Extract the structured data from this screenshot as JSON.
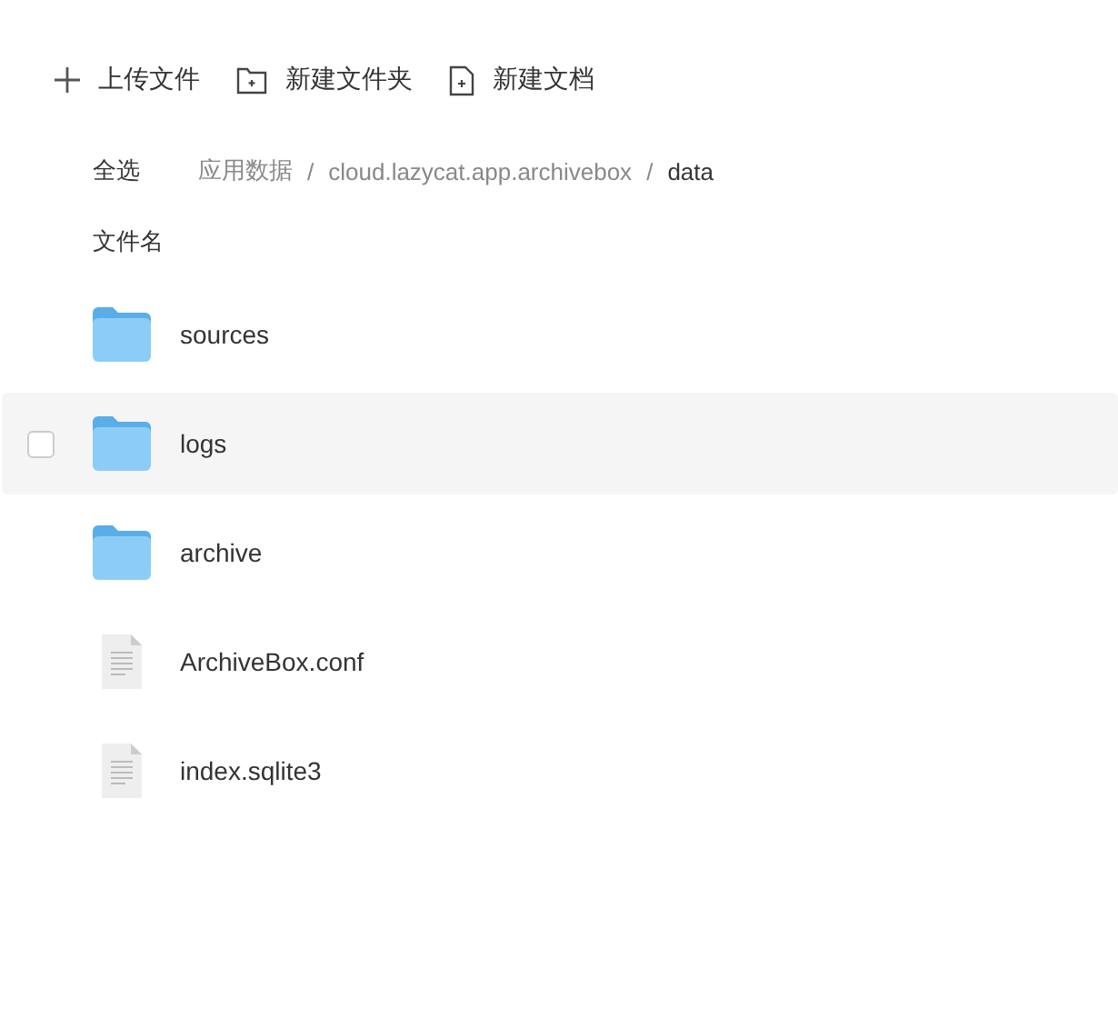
{
  "toolbar": [
    {
      "kind": "upload",
      "label": "上传文件"
    },
    {
      "kind": "folder",
      "label": "新建文件夹"
    },
    {
      "kind": "doc",
      "label": "新建文档"
    }
  ],
  "select_all": "全选",
  "breadcrumb": [
    {
      "label": "应用数据",
      "current": false
    },
    {
      "label": "cloud.lazycat.app.archivebox",
      "current": false
    },
    {
      "label": "data",
      "current": true
    }
  ],
  "separator": "/",
  "column_header": "文件名",
  "files": [
    {
      "kind": "folder",
      "name": "sources",
      "hovered": false
    },
    {
      "kind": "folder",
      "name": "logs",
      "hovered": true,
      "checked": false
    },
    {
      "kind": "folder",
      "name": "archive",
      "hovered": false
    },
    {
      "kind": "file",
      "name": "ArchiveBox.conf",
      "hovered": false
    },
    {
      "kind": "file",
      "name": "index.sqlite3",
      "hovered": false
    }
  ]
}
